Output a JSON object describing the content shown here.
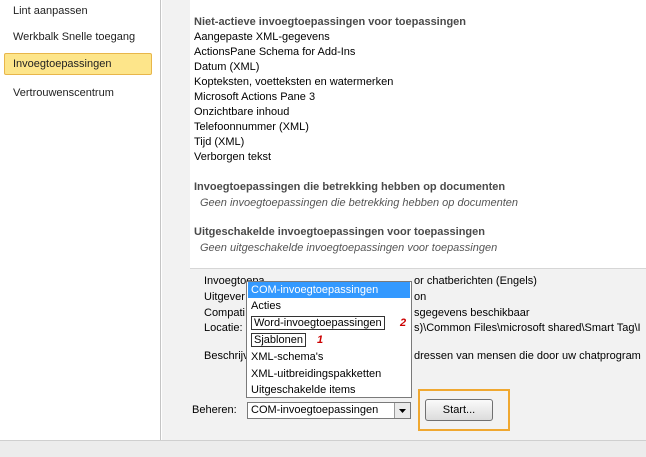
{
  "sidebar": {
    "items": [
      {
        "label": "Lint aanpassen"
      },
      {
        "label": "Werkbalk Snelle toegang"
      },
      {
        "label": "Invoegtoepassingen"
      },
      {
        "label": "Vertrouwenscentrum"
      }
    ]
  },
  "inactive": {
    "heading": "Niet-actieve invoegtoepassingen voor toepassingen",
    "items": [
      "Aangepaste XML-gegevens",
      "ActionsPane Schema for Add-Ins",
      "Datum (XML)",
      "Kopteksten, voetteksten en watermerken",
      "Microsoft Actions Pane 3",
      "Onzichtbare inhoud",
      "Telefoonnummer (XML)",
      "Tijd (XML)",
      "Verborgen tekst"
    ]
  },
  "document_addins": {
    "heading": "Invoegtoepassingen die betrekking hebben op documenten",
    "note": "Geen invoegtoepassingen die betrekking hebben op documenten"
  },
  "disabled_addins": {
    "heading": "Uitgeschakelde invoegtoepassingen voor toepassingen",
    "note": "Geen uitgeschakelde invoegtoepassingen voor toepassingen"
  },
  "details": {
    "addin_label": "Invoegtoepa",
    "addin_value_tail": "or chatberichten (Engels)",
    "publisher_label": "Uitgever",
    "publisher_tail": "on",
    "compat_label": "Compati",
    "compat_tail": "sgegevens beschikbaar",
    "location_label": "Locatie:",
    "location_tail": "s)\\Common Files\\microsoft shared\\Smart Tag\\I",
    "description_label": "Beschrijv",
    "description_tail": "dressen van mensen die door uw chatprogram"
  },
  "dropdown": {
    "options": [
      "COM-invoegtoepassingen",
      "Acties",
      "Word-invoegtoepassingen",
      "Sjablonen",
      "XML-schema's",
      "XML-uitbreidingspakketten",
      "Uitgeschakelde items"
    ],
    "highlighted": "COM-invoegtoepassingen",
    "marker_2": "2",
    "marker_1": "1"
  },
  "manage": {
    "label": "Beheren:",
    "selected": "COM-invoegtoepassingen",
    "start_button": "Start..."
  },
  "colors": {
    "selection": "#fde58a",
    "highlight": "#3399ff",
    "annotation_box": "#f0a830",
    "annotation_number": "#cc0000"
  }
}
